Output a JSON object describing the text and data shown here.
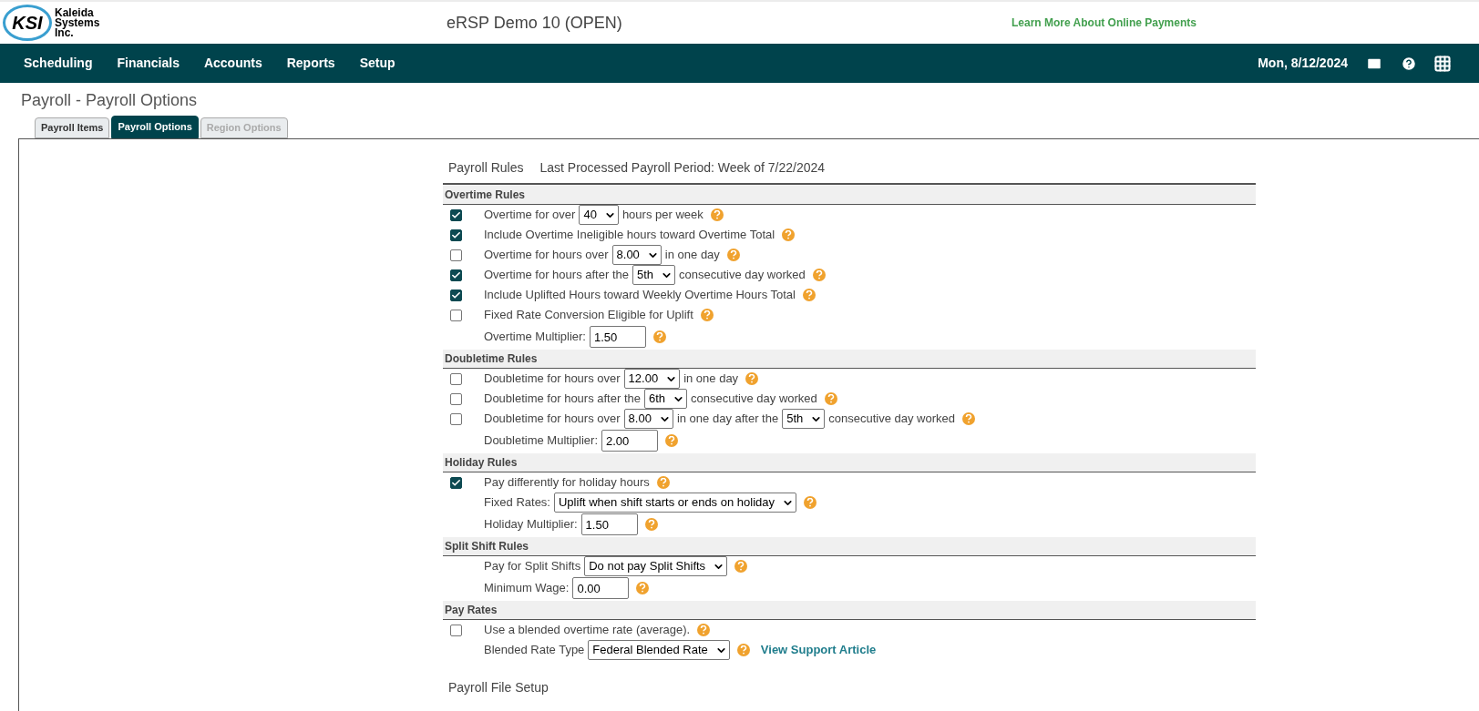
{
  "header": {
    "logo": {
      "mark": "KSI",
      "lines": [
        "Kaleida",
        "Systems",
        "Inc."
      ]
    },
    "title": "eRSP Demo 10 (OPEN)",
    "promo_link": "Learn More About Online Payments"
  },
  "nav": {
    "items": [
      "Scheduling",
      "Financials",
      "Accounts",
      "Reports",
      "Setup"
    ],
    "date": "Mon, 8/12/2024"
  },
  "page_title": "Payroll - Payroll Options",
  "tabs": [
    {
      "label": "Payroll Items",
      "selected": false,
      "disabled": false
    },
    {
      "label": "Payroll Options",
      "selected": true,
      "disabled": false
    },
    {
      "label": "Region Options",
      "selected": false,
      "disabled": true
    }
  ],
  "rules": {
    "title": "Payroll Rules",
    "last_processed": "Last Processed Payroll Period: Week of 7/22/2024",
    "sections": [
      {
        "title": "Overtime Rules",
        "rows": [
          {
            "kind": "check",
            "checked": true,
            "parts": [
              {
                "kind": "text",
                "text": "Overtime for over"
              },
              {
                "kind": "select",
                "value": "40"
              },
              {
                "kind": "text",
                "text": "hours per week"
              },
              {
                "kind": "help"
              }
            ]
          },
          {
            "kind": "check",
            "checked": true,
            "parts": [
              {
                "kind": "text",
                "text": "Include Overtime Ineligible hours toward Overtime Total"
              },
              {
                "kind": "help"
              }
            ]
          },
          {
            "kind": "check",
            "checked": false,
            "parts": [
              {
                "kind": "text",
                "text": "Overtime for hours over"
              },
              {
                "kind": "select",
                "value": "8.00"
              },
              {
                "kind": "text",
                "text": "in one day"
              },
              {
                "kind": "help"
              }
            ]
          },
          {
            "kind": "check",
            "checked": true,
            "parts": [
              {
                "kind": "text",
                "text": "Overtime for hours after the"
              },
              {
                "kind": "select",
                "value": "5th"
              },
              {
                "kind": "text",
                "text": "consecutive day worked"
              },
              {
                "kind": "help"
              }
            ]
          },
          {
            "kind": "check",
            "checked": true,
            "parts": [
              {
                "kind": "text",
                "text": "Include Uplifted Hours toward Weekly Overtime Hours Total"
              },
              {
                "kind": "help"
              }
            ]
          },
          {
            "kind": "check",
            "checked": false,
            "parts": [
              {
                "kind": "text",
                "text": "Fixed Rate Conversion Eligible for Uplift"
              },
              {
                "kind": "help"
              }
            ]
          },
          {
            "kind": "plain",
            "parts": [
              {
                "kind": "text",
                "text": "Overtime Multiplier:"
              },
              {
                "kind": "input",
                "value": "1.50"
              },
              {
                "kind": "help"
              }
            ]
          }
        ]
      },
      {
        "title": "Doubletime Rules",
        "rows": [
          {
            "kind": "check",
            "checked": false,
            "parts": [
              {
                "kind": "text",
                "text": "Doubletime for hours over"
              },
              {
                "kind": "select",
                "value": "12.00"
              },
              {
                "kind": "text",
                "text": "in one day"
              },
              {
                "kind": "help"
              }
            ]
          },
          {
            "kind": "check",
            "checked": false,
            "parts": [
              {
                "kind": "text",
                "text": "Doubletime for hours after the"
              },
              {
                "kind": "select",
                "value": "6th"
              },
              {
                "kind": "text",
                "text": "consecutive day worked"
              },
              {
                "kind": "help"
              }
            ]
          },
          {
            "kind": "check",
            "checked": false,
            "parts": [
              {
                "kind": "text",
                "text": "Doubletime for hours over"
              },
              {
                "kind": "select",
                "value": "8.00"
              },
              {
                "kind": "text",
                "text": "in one day after the"
              },
              {
                "kind": "select",
                "value": "5th"
              },
              {
                "kind": "text",
                "text": "consecutive day worked"
              },
              {
                "kind": "help"
              }
            ]
          },
          {
            "kind": "plain",
            "parts": [
              {
                "kind": "text",
                "text": "Doubletime Multiplier:"
              },
              {
                "kind": "input",
                "value": "2.00"
              },
              {
                "kind": "help"
              }
            ]
          }
        ]
      },
      {
        "title": "Holiday Rules",
        "rows": [
          {
            "kind": "check",
            "checked": true,
            "parts": [
              {
                "kind": "text",
                "text": "Pay differently for holiday hours"
              },
              {
                "kind": "help"
              }
            ]
          },
          {
            "kind": "plain",
            "parts": [
              {
                "kind": "text",
                "text": "Fixed Rates:"
              },
              {
                "kind": "select",
                "value": "Uplift when shift starts or ends on holiday"
              },
              {
                "kind": "help"
              }
            ]
          },
          {
            "kind": "plain",
            "parts": [
              {
                "kind": "text",
                "text": "Holiday Multiplier:"
              },
              {
                "kind": "input",
                "value": "1.50"
              },
              {
                "kind": "help"
              }
            ]
          }
        ]
      },
      {
        "title": "Split Shift Rules",
        "rows": [
          {
            "kind": "plain",
            "parts": [
              {
                "kind": "text",
                "text": "Pay for Split Shifts"
              },
              {
                "kind": "select",
                "value": "Do not pay Split Shifts"
              },
              {
                "kind": "help"
              }
            ]
          },
          {
            "kind": "plain",
            "parts": [
              {
                "kind": "text",
                "text": "Minimum Wage:"
              },
              {
                "kind": "input",
                "value": "0.00"
              },
              {
                "kind": "help"
              }
            ]
          }
        ]
      },
      {
        "title": "Pay Rates",
        "rows": [
          {
            "kind": "check",
            "checked": false,
            "parts": [
              {
                "kind": "text",
                "text": "Use a blended overtime rate (average)."
              },
              {
                "kind": "help"
              }
            ]
          },
          {
            "kind": "plain",
            "parts": [
              {
                "kind": "text",
                "text": "Blended Rate Type"
              },
              {
                "kind": "select",
                "value": "Federal Blended Rate"
              },
              {
                "kind": "help"
              },
              {
                "kind": "link",
                "text": "View Support Article"
              }
            ]
          }
        ]
      }
    ]
  },
  "file_setup_title": "Payroll File Setup"
}
